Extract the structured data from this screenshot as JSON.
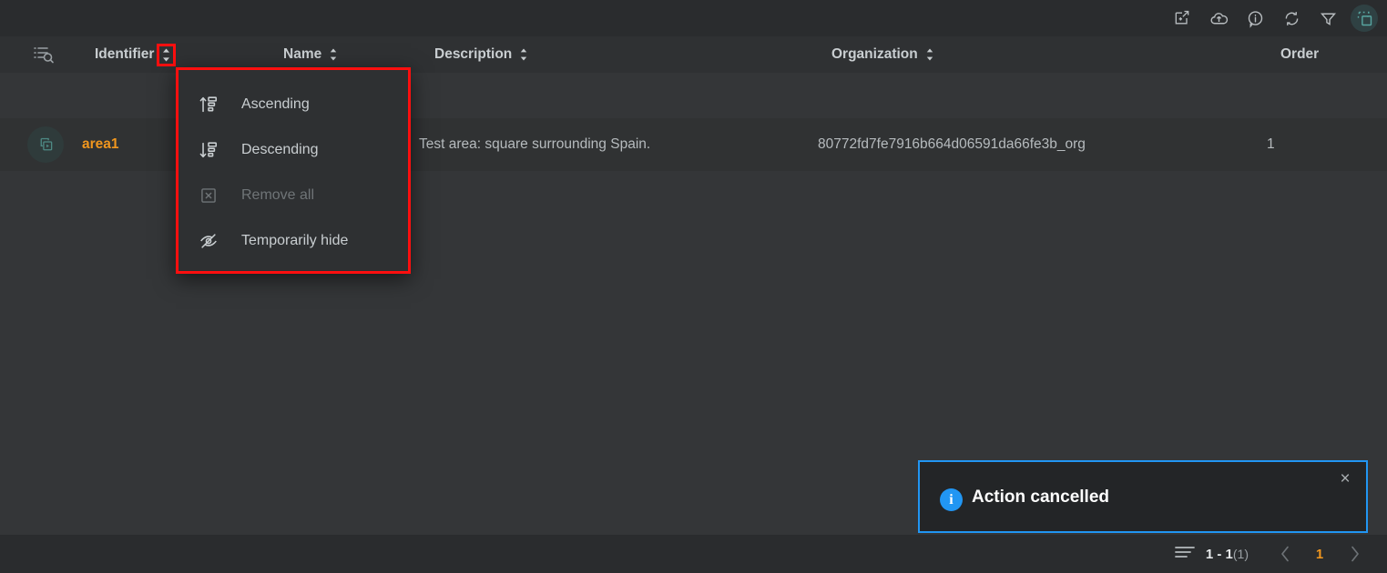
{
  "toolbar": {
    "buttons": [
      {
        "name": "export-icon",
        "title": "Export"
      },
      {
        "name": "cloud-upload-icon",
        "title": "Upload"
      },
      {
        "name": "info-icon",
        "title": "Information"
      },
      {
        "name": "refresh-icon",
        "title": "Refresh"
      },
      {
        "name": "filter-icon",
        "title": "Filter"
      },
      {
        "name": "select-duplicate-icon",
        "title": "Selection mode"
      }
    ],
    "active_accent": "#58a6a1"
  },
  "table": {
    "search_icon": "search-list-icon",
    "columns": [
      {
        "label": "Identifier",
        "sortable": true,
        "highlighted": true
      },
      {
        "label": "Name",
        "sortable": true,
        "highlighted": false
      },
      {
        "label": "Description",
        "sortable": true,
        "highlighted": false
      },
      {
        "label": "Organization",
        "sortable": true,
        "highlighted": false
      },
      {
        "label": "Order",
        "sortable": false,
        "highlighted": false
      }
    ],
    "rows": [
      {
        "icon": "area-copy-icon",
        "identifier": "area1",
        "name": "",
        "description": "Test area: square surrounding Spain.",
        "organization": "80772fd7fe7916b664d06591da66fe3b_org",
        "order": "1"
      }
    ],
    "identifier_color": "#f0961e"
  },
  "context_menu": {
    "border_color": "#ff0f0f",
    "items": [
      {
        "label": "Ascending",
        "icon": "sort-ascending-icon",
        "disabled": false
      },
      {
        "label": "Descending",
        "icon": "sort-descending-icon",
        "disabled": false
      },
      {
        "label": "Remove all",
        "icon": "remove-box-icon",
        "disabled": true
      },
      {
        "label": "Temporarily hide",
        "icon": "eye-off-icon",
        "disabled": false
      }
    ]
  },
  "toast": {
    "message": "Action cancelled",
    "icon": "info-circle-icon",
    "icon_glyph": "i",
    "close_glyph": "×",
    "accent_color": "#2196f3"
  },
  "pagination": {
    "list_icon": "list-lines-icon",
    "range": "1 - 1",
    "total": "(1)",
    "prev_glyph": "‹",
    "next_glyph": "›",
    "current_page": "1",
    "page_color": "#f0961e"
  }
}
